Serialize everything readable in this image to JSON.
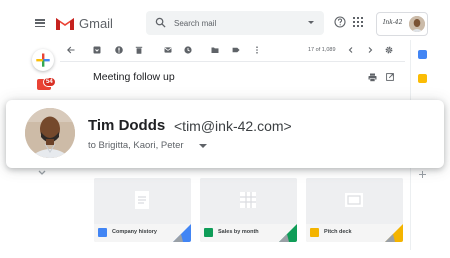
{
  "app": {
    "name": "Gmail"
  },
  "header": {
    "search_placeholder": "Search mail",
    "brand_mark": "Ink-42",
    "icons": [
      "menu-icon",
      "gmail-logo",
      "search-icon",
      "help-icon",
      "apps-icon"
    ]
  },
  "left_rail": {
    "unread_badge": "54"
  },
  "toolbar": {
    "page_count": "17 of 1,089",
    "icons": [
      "back-arrow-icon",
      "archive-icon",
      "report-spam-icon",
      "delete-icon",
      "mark-unread-icon",
      "snooze-icon",
      "move-to-icon",
      "label-icon",
      "more-icon",
      "prev-icon",
      "next-icon",
      "settings-icon"
    ]
  },
  "message": {
    "subject": "Meeting follow up",
    "sender_name": "Tim Dodds",
    "sender_email": "<tim@ink-42.com>",
    "recipients": "to Brigitta, Kaori, Peter"
  },
  "attachments": [
    {
      "label": "Company history",
      "type_color": "#4285f4",
      "corner_color": "#4285f4"
    },
    {
      "label": "Sales by month",
      "type_color": "#0f9d58",
      "corner_color": "#0f9d58"
    },
    {
      "label": "Pitch deck",
      "type_color": "#f4b400",
      "corner_color": "#f4b400"
    }
  ],
  "colors": {
    "gmail_red": "#ea4335",
    "badge_red": "#d93025",
    "docs_blue": "#4285f4",
    "sheets_green": "#0f9d58",
    "slides_yellow": "#f4b400",
    "keep_yellow": "#fbbc04"
  }
}
